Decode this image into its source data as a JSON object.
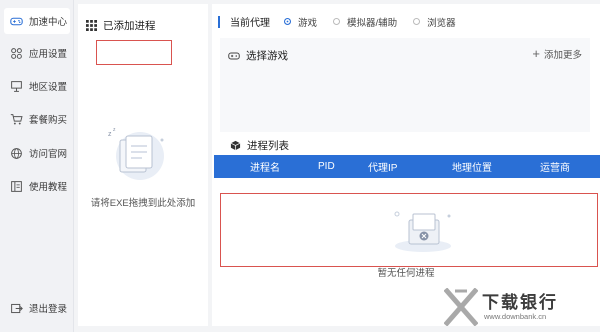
{
  "sidebar": {
    "items": [
      {
        "label": "加速中心",
        "icon": "gamepad-icon",
        "active": true
      },
      {
        "label": "应用设置",
        "icon": "apps-grid-icon"
      },
      {
        "label": "地区设置",
        "icon": "globe-stand-icon"
      },
      {
        "label": "套餐购买",
        "icon": "cart-icon"
      },
      {
        "label": "访问官网",
        "icon": "browser-globe-icon"
      },
      {
        "label": "使用教程",
        "icon": "book-icon"
      }
    ],
    "logout": "退出登录"
  },
  "process_panel": {
    "title": "已添加进程",
    "drop_hint": "请将EXE拖拽到此处添加"
  },
  "main": {
    "proxy_label": "当前代理",
    "proxy_options": [
      {
        "label": "游戏",
        "checked": true
      },
      {
        "label": "模拟器/辅助",
        "checked": false
      },
      {
        "label": "浏览器",
        "checked": false
      }
    ],
    "game_section": {
      "title": "选择游戏",
      "add_more": "添加更多"
    },
    "process_list": {
      "title": "进程列表",
      "columns": [
        "进程名",
        "PID",
        "代理IP",
        "地理位置",
        "运营商"
      ],
      "empty_text": "暂无任何进程"
    }
  },
  "watermark": {
    "title": "下载银行",
    "url": "www.downbank.cn"
  },
  "colors": {
    "accent": "#2a6fd6",
    "highlight_border": "#d9534f",
    "sidebar_bg": "#f1f2f5"
  }
}
